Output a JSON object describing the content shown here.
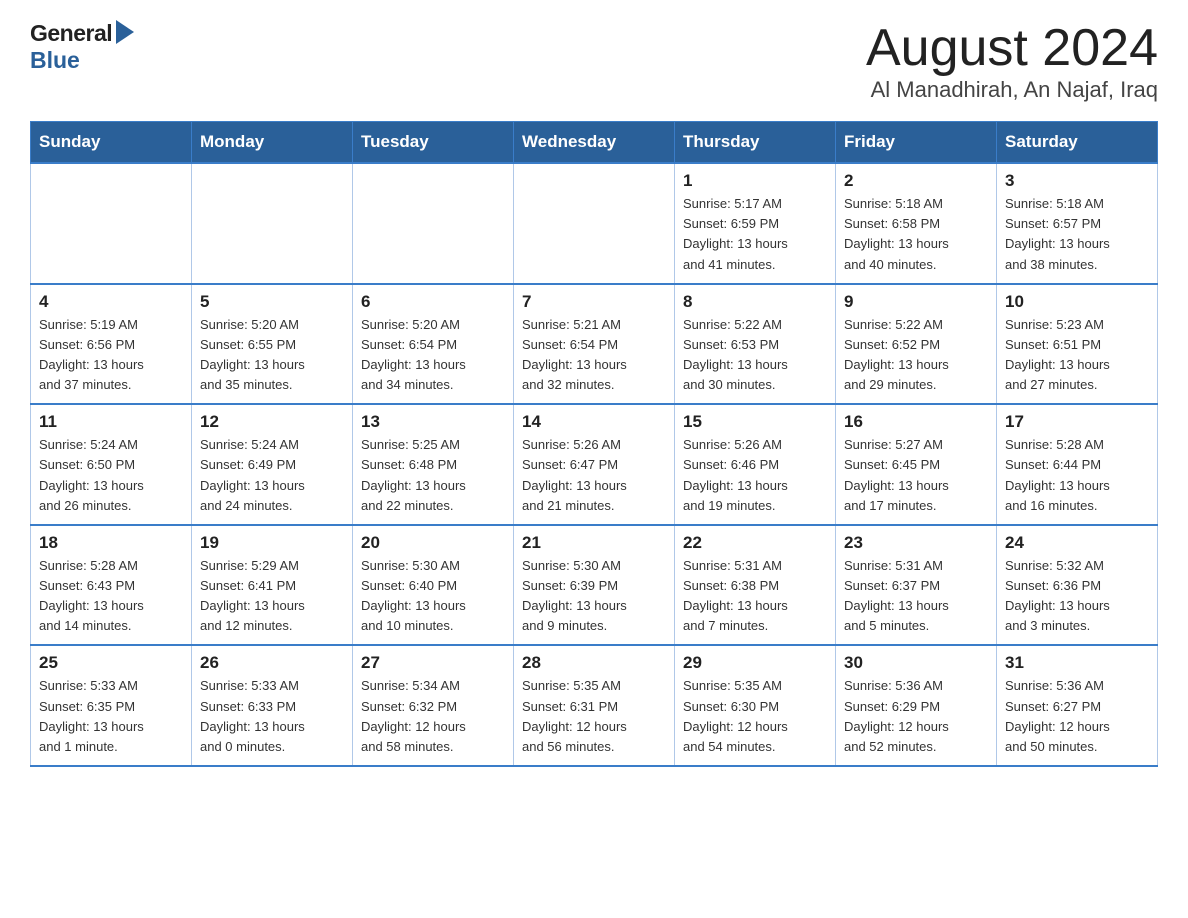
{
  "header": {
    "logo_general": "General",
    "logo_blue": "Blue",
    "title": "August 2024",
    "subtitle": "Al Manadhirah, An Najaf, Iraq"
  },
  "days_of_week": [
    "Sunday",
    "Monday",
    "Tuesday",
    "Wednesday",
    "Thursday",
    "Friday",
    "Saturday"
  ],
  "weeks": [
    [
      {
        "day": "",
        "info": ""
      },
      {
        "day": "",
        "info": ""
      },
      {
        "day": "",
        "info": ""
      },
      {
        "day": "",
        "info": ""
      },
      {
        "day": "1",
        "info": "Sunrise: 5:17 AM\nSunset: 6:59 PM\nDaylight: 13 hours\nand 41 minutes."
      },
      {
        "day": "2",
        "info": "Sunrise: 5:18 AM\nSunset: 6:58 PM\nDaylight: 13 hours\nand 40 minutes."
      },
      {
        "day": "3",
        "info": "Sunrise: 5:18 AM\nSunset: 6:57 PM\nDaylight: 13 hours\nand 38 minutes."
      }
    ],
    [
      {
        "day": "4",
        "info": "Sunrise: 5:19 AM\nSunset: 6:56 PM\nDaylight: 13 hours\nand 37 minutes."
      },
      {
        "day": "5",
        "info": "Sunrise: 5:20 AM\nSunset: 6:55 PM\nDaylight: 13 hours\nand 35 minutes."
      },
      {
        "day": "6",
        "info": "Sunrise: 5:20 AM\nSunset: 6:54 PM\nDaylight: 13 hours\nand 34 minutes."
      },
      {
        "day": "7",
        "info": "Sunrise: 5:21 AM\nSunset: 6:54 PM\nDaylight: 13 hours\nand 32 minutes."
      },
      {
        "day": "8",
        "info": "Sunrise: 5:22 AM\nSunset: 6:53 PM\nDaylight: 13 hours\nand 30 minutes."
      },
      {
        "day": "9",
        "info": "Sunrise: 5:22 AM\nSunset: 6:52 PM\nDaylight: 13 hours\nand 29 minutes."
      },
      {
        "day": "10",
        "info": "Sunrise: 5:23 AM\nSunset: 6:51 PM\nDaylight: 13 hours\nand 27 minutes."
      }
    ],
    [
      {
        "day": "11",
        "info": "Sunrise: 5:24 AM\nSunset: 6:50 PM\nDaylight: 13 hours\nand 26 minutes."
      },
      {
        "day": "12",
        "info": "Sunrise: 5:24 AM\nSunset: 6:49 PM\nDaylight: 13 hours\nand 24 minutes."
      },
      {
        "day": "13",
        "info": "Sunrise: 5:25 AM\nSunset: 6:48 PM\nDaylight: 13 hours\nand 22 minutes."
      },
      {
        "day": "14",
        "info": "Sunrise: 5:26 AM\nSunset: 6:47 PM\nDaylight: 13 hours\nand 21 minutes."
      },
      {
        "day": "15",
        "info": "Sunrise: 5:26 AM\nSunset: 6:46 PM\nDaylight: 13 hours\nand 19 minutes."
      },
      {
        "day": "16",
        "info": "Sunrise: 5:27 AM\nSunset: 6:45 PM\nDaylight: 13 hours\nand 17 minutes."
      },
      {
        "day": "17",
        "info": "Sunrise: 5:28 AM\nSunset: 6:44 PM\nDaylight: 13 hours\nand 16 minutes."
      }
    ],
    [
      {
        "day": "18",
        "info": "Sunrise: 5:28 AM\nSunset: 6:43 PM\nDaylight: 13 hours\nand 14 minutes."
      },
      {
        "day": "19",
        "info": "Sunrise: 5:29 AM\nSunset: 6:41 PM\nDaylight: 13 hours\nand 12 minutes."
      },
      {
        "day": "20",
        "info": "Sunrise: 5:30 AM\nSunset: 6:40 PM\nDaylight: 13 hours\nand 10 minutes."
      },
      {
        "day": "21",
        "info": "Sunrise: 5:30 AM\nSunset: 6:39 PM\nDaylight: 13 hours\nand 9 minutes."
      },
      {
        "day": "22",
        "info": "Sunrise: 5:31 AM\nSunset: 6:38 PM\nDaylight: 13 hours\nand 7 minutes."
      },
      {
        "day": "23",
        "info": "Sunrise: 5:31 AM\nSunset: 6:37 PM\nDaylight: 13 hours\nand 5 minutes."
      },
      {
        "day": "24",
        "info": "Sunrise: 5:32 AM\nSunset: 6:36 PM\nDaylight: 13 hours\nand 3 minutes."
      }
    ],
    [
      {
        "day": "25",
        "info": "Sunrise: 5:33 AM\nSunset: 6:35 PM\nDaylight: 13 hours\nand 1 minute."
      },
      {
        "day": "26",
        "info": "Sunrise: 5:33 AM\nSunset: 6:33 PM\nDaylight: 13 hours\nand 0 minutes."
      },
      {
        "day": "27",
        "info": "Sunrise: 5:34 AM\nSunset: 6:32 PM\nDaylight: 12 hours\nand 58 minutes."
      },
      {
        "day": "28",
        "info": "Sunrise: 5:35 AM\nSunset: 6:31 PM\nDaylight: 12 hours\nand 56 minutes."
      },
      {
        "day": "29",
        "info": "Sunrise: 5:35 AM\nSunset: 6:30 PM\nDaylight: 12 hours\nand 54 minutes."
      },
      {
        "day": "30",
        "info": "Sunrise: 5:36 AM\nSunset: 6:29 PM\nDaylight: 12 hours\nand 52 minutes."
      },
      {
        "day": "31",
        "info": "Sunrise: 5:36 AM\nSunset: 6:27 PM\nDaylight: 12 hours\nand 50 minutes."
      }
    ]
  ]
}
